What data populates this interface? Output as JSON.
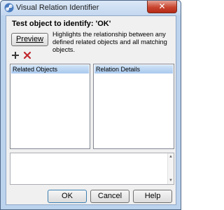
{
  "window": {
    "title": "Visual Relation Identifier",
    "close_label": "✕"
  },
  "heading": "Test object to identify: 'OK'",
  "preview": {
    "label": "Preview",
    "description": "Highlights the relationship between any defined related objects and all matching objects."
  },
  "toolbar": {
    "add_label": "add-icon",
    "delete_label": "delete-icon"
  },
  "panels": {
    "related_objects_header": "Related Objects",
    "relation_details_header": "Relation Details"
  },
  "scrollbar": {
    "up_arrow": "▲",
    "down_arrow": "▼"
  },
  "buttons": {
    "ok": "OK",
    "cancel": "Cancel",
    "help": "Help"
  },
  "colors": {
    "frame": "#bcd3ee",
    "close": "#c8452f",
    "add_icon": "#3a3a3a",
    "delete_icon": "#c0272d",
    "header": "#bcd6f2"
  }
}
